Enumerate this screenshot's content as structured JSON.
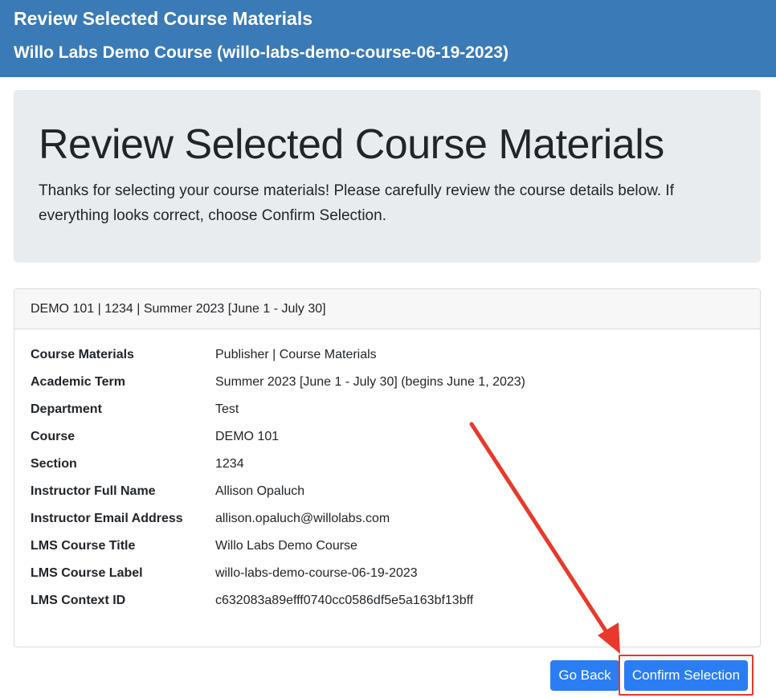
{
  "header": {
    "title": "Review Selected Course Materials",
    "subtitle": "Willo Labs Demo Course (willo-labs-demo-course-06-19-2023)"
  },
  "intro": {
    "heading": "Review Selected Course Materials",
    "message": "Thanks for selecting your course materials! Please carefully review the course details below. If everything looks correct, choose Confirm Selection."
  },
  "card": {
    "header": "DEMO 101 | 1234 | Summer 2023 [June 1 - July 30]",
    "rows": [
      {
        "label": "Course Materials",
        "value": "Publisher | Course Materials"
      },
      {
        "label": "Academic Term",
        "value": "Summer 2023 [June 1 - July 30] (begins June 1, 2023)"
      },
      {
        "label": "Department",
        "value": "Test"
      },
      {
        "label": "Course",
        "value": "DEMO 101"
      },
      {
        "label": "Section",
        "value": "1234"
      },
      {
        "label": "Instructor Full Name",
        "value": "Allison Opaluch"
      },
      {
        "label": "Instructor Email Address",
        "value": "allison.opaluch@willolabs.com"
      },
      {
        "label": "LMS Course Title",
        "value": "Willo Labs Demo Course"
      },
      {
        "label": "LMS Course Label",
        "value": "willo-labs-demo-course-06-19-2023"
      },
      {
        "label": "LMS Context ID",
        "value": "c632083a89efff0740cc0586df5e5a163bf13bff"
      }
    ]
  },
  "actions": {
    "go_back_label": "Go Back",
    "confirm_label": "Confirm Selection"
  },
  "colors": {
    "header_bg": "#3a7ab6",
    "button": "#2a7df3",
    "annotation": "#e8392b"
  }
}
